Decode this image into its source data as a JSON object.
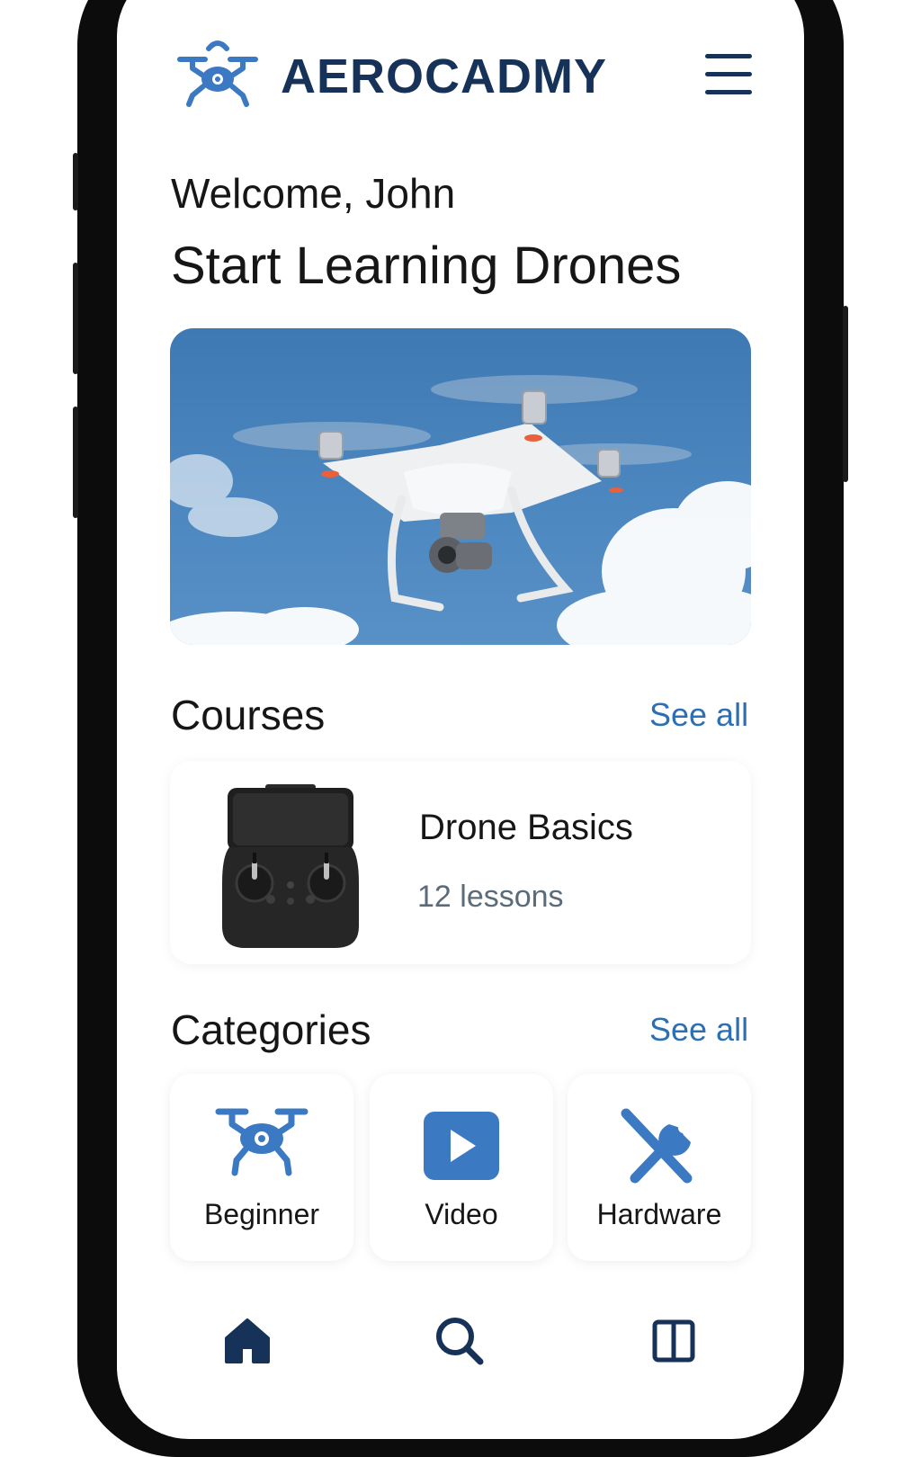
{
  "app": {
    "brand_name": "AEROCADMY"
  },
  "colors": {
    "brand_dark": "#163258",
    "accent_blue": "#2d6fb3",
    "icon_blue": "#3b7ac2"
  },
  "icons": {
    "logo": "drone-logo-icon",
    "menu": "hamburger-menu-icon",
    "nav_home": "home-icon",
    "nav_search": "search-icon",
    "nav_library": "library-icon"
  },
  "header": {
    "greeting": "Welcome, John",
    "headline": "Start Learning Drones"
  },
  "courses": {
    "title": "Courses",
    "see_all": "See all",
    "items": [
      {
        "title": "Drone Basics",
        "subtitle": "12 lessons",
        "thumbnail": "remote-controller"
      }
    ]
  },
  "categories": {
    "title": "Categories",
    "see_all": "See all",
    "items": [
      {
        "label": "Beginner",
        "icon": "drone-icon"
      },
      {
        "label": "Video",
        "icon": "play-icon"
      },
      {
        "label": "Hardware",
        "icon": "tools-icon"
      }
    ]
  }
}
